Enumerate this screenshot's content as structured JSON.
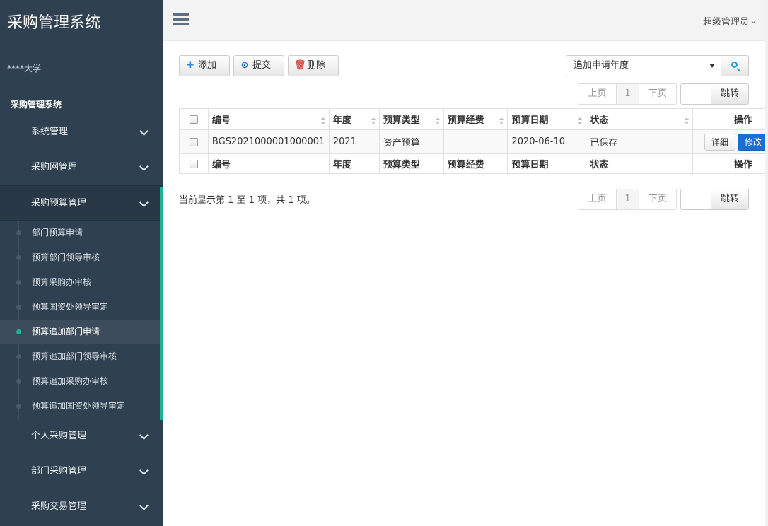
{
  "sidebar": {
    "brand": "采购管理系统",
    "org": "****大学",
    "section_label": "采购管理系统",
    "menu_top": [
      {
        "label": "系统管理"
      },
      {
        "label": "采购网管理"
      }
    ],
    "open_menu": {
      "label": "采购预算管理",
      "items": [
        {
          "label": "部门预算申请"
        },
        {
          "label": "预算部门领导审核"
        },
        {
          "label": "预算采购办审核"
        },
        {
          "label": "预算国资处领导审定"
        },
        {
          "label": "预算追加部门申请"
        },
        {
          "label": "预算追加部门领导审核"
        },
        {
          "label": "预算追加采购办审核"
        },
        {
          "label": "预算追加国资处领导审定"
        }
      ],
      "active_index": 4
    },
    "menu_bottom": [
      {
        "label": "个人采购管理"
      },
      {
        "label": "部门采购管理"
      },
      {
        "label": "采购交易管理"
      }
    ]
  },
  "header": {
    "menu_icon": "hamburger-icon",
    "user_label": "超级管理员"
  },
  "toolbar": {
    "add_label": "添加",
    "submit_label": "提交",
    "delete_label": "删除",
    "year_select_value": "追加申请年度",
    "search_icon": "search-icon"
  },
  "pager": {
    "prev_label": "上页",
    "page_number": "1",
    "next_label": "下页",
    "jump_label": "跳转"
  },
  "table": {
    "columns": [
      "编号",
      "年度",
      "预算类型",
      "预算经费",
      "预算日期",
      "状态",
      "操作"
    ],
    "rows": [
      {
        "id": "BGS2021000001000001",
        "year": "2021",
        "type": "资产预算",
        "amount": "",
        "date": "2020-06-10",
        "status": "已保存",
        "detail_label": "详细",
        "edit_label": "修改"
      }
    ]
  },
  "summary": "当前显示第 1 至 1 项，共 1 项。",
  "colors": {
    "sidebar_bg": "#2f4050",
    "accent": "#1ab394",
    "primary": "#1c6fd1"
  }
}
